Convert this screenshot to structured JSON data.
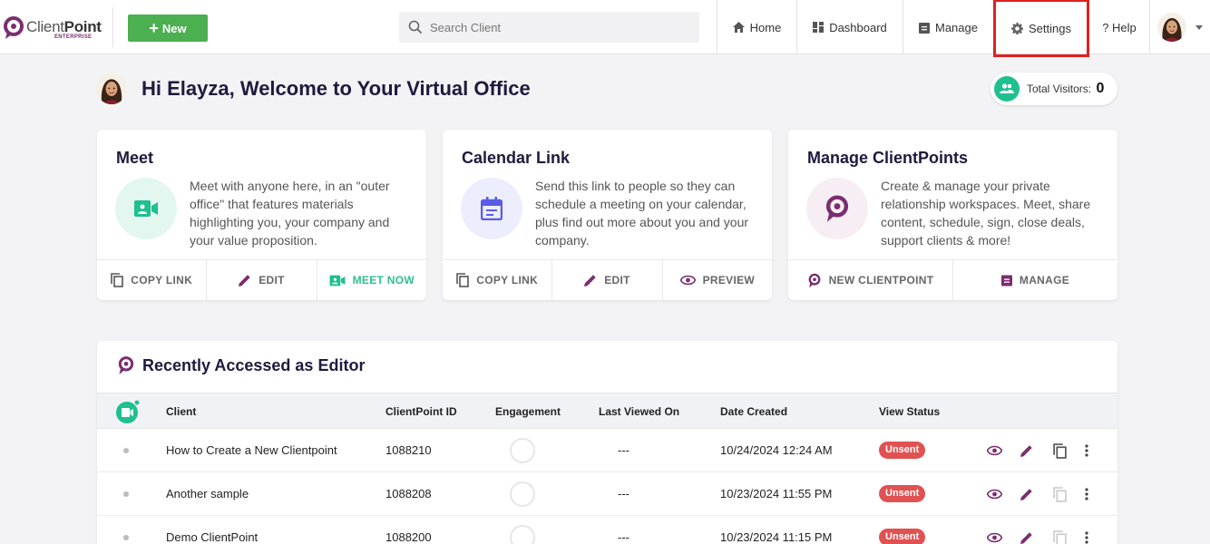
{
  "brand": {
    "name_light": "Client",
    "name_bold": "Point",
    "tagline": "ENTERPRISE"
  },
  "toolbar": {
    "new_label": "New"
  },
  "search": {
    "placeholder": "Search Client"
  },
  "nav": {
    "home": "Home",
    "dashboard": "Dashboard",
    "manage": "Manage",
    "settings": "Settings",
    "help": "? Help"
  },
  "welcome": {
    "title": "Hi Elayza, Welcome to Your Virtual Office"
  },
  "visitors": {
    "label": "Total Visitors:",
    "count": "0"
  },
  "cards": {
    "meet": {
      "title": "Meet",
      "desc": "Meet with anyone here, in an \"outer office\" that features materials highlighting you, your company and your value proposition.",
      "actions": [
        "COPY LINK",
        "EDIT",
        "MEET NOW"
      ]
    },
    "calendar": {
      "title": "Calendar Link",
      "desc": "Send this link to people so they can schedule a meeting on your calendar, plus find out more about you and your company.",
      "actions": [
        "COPY LINK",
        "EDIT",
        "PREVIEW"
      ]
    },
    "manage": {
      "title": "Manage ClientPoints",
      "desc": "Create & manage your private relationship workspaces. Meet, share content, schedule, sign, close deals, support clients & more!",
      "actions": [
        "NEW CLIENTPOINT",
        "MANAGE"
      ]
    }
  },
  "recent": {
    "title": "Recently Accessed as Editor",
    "columns": [
      "Client",
      "ClientPoint ID",
      "Engagement",
      "Last Viewed On",
      "Date Created",
      "View Status"
    ],
    "rows": [
      {
        "client": "How to Create a New Clientpoint",
        "id": "1088210",
        "last_viewed": "---",
        "created": "10/24/2024 12:24 AM",
        "status": "Unsent"
      },
      {
        "client": "Another sample",
        "id": "1088208",
        "last_viewed": "---",
        "created": "10/23/2024 11:55 PM",
        "status": "Unsent"
      },
      {
        "client": "Demo ClientPoint",
        "id": "1088200",
        "last_viewed": "---",
        "created": "10/23/2024 11:15 PM",
        "status": "Unsent"
      }
    ]
  },
  "colors": {
    "brand": "#7a2e6f",
    "accent_green": "#4caf50",
    "teal": "#1fbf8f",
    "badge_red": "#e05252",
    "highlight": "#e02020"
  }
}
